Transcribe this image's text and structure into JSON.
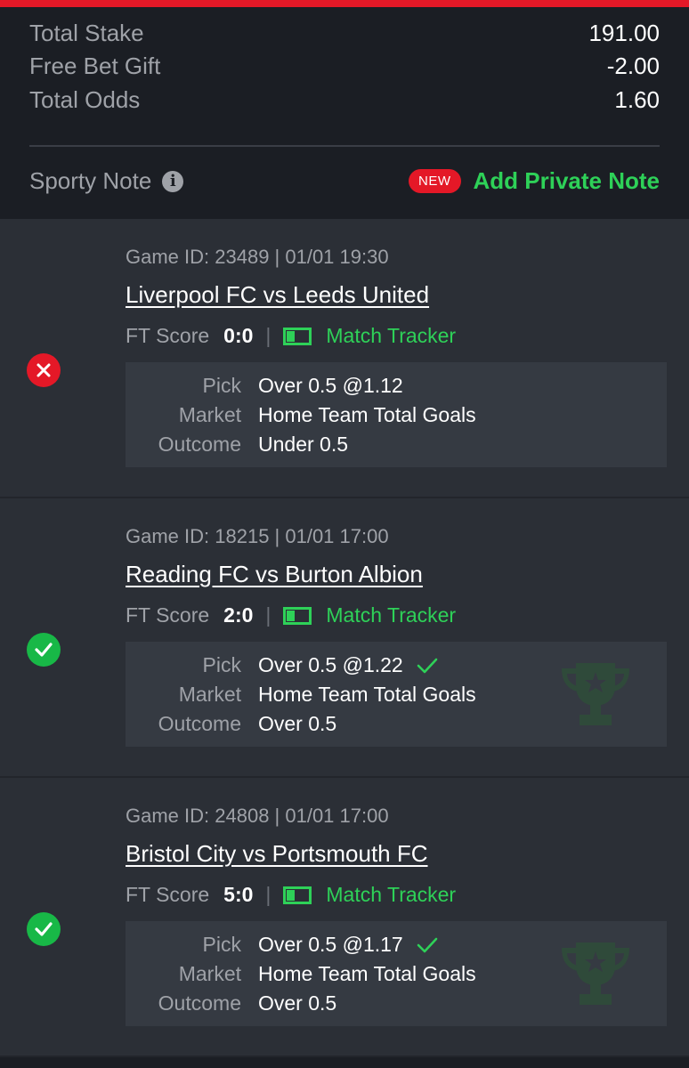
{
  "summary": {
    "total_stake_label": "Total Stake",
    "total_stake_value": "191.00",
    "free_bet_label": "Free Bet Gift",
    "free_bet_value": "-2.00",
    "total_odds_label": "Total Odds",
    "total_odds_value": "1.60"
  },
  "note": {
    "label": "Sporty Note",
    "info_icon": "info-icon",
    "badge": "NEW",
    "action": "Add Private Note"
  },
  "bets": [
    {
      "status": "lost",
      "game_id": "Game ID: 23489 | 01/01 19:30",
      "match": "Liverpool FC vs Leeds United",
      "ft_label": "FT Score",
      "ft_score": "0:0",
      "separator": "|",
      "tracker": "Match Tracker",
      "pick_label": "Pick",
      "pick": "Over 0.5 @1.12",
      "market_label": "Market",
      "market": "Home Team Total Goals",
      "outcome_label": "Outcome",
      "outcome": "Under 0.5"
    },
    {
      "status": "won",
      "game_id": "Game ID: 18215 | 01/01 17:00",
      "match": "Reading FC vs Burton Albion",
      "ft_label": "FT Score",
      "ft_score": "2:0",
      "separator": "|",
      "tracker": "Match Tracker",
      "pick_label": "Pick",
      "pick": "Over 0.5 @1.22",
      "market_label": "Market",
      "market": "Home Team Total Goals",
      "outcome_label": "Outcome",
      "outcome": "Over 0.5"
    },
    {
      "status": "won",
      "game_id": "Game ID: 24808 | 01/01 17:00",
      "match": "Bristol City vs Portsmouth FC",
      "ft_label": "FT Score",
      "ft_score": "5:0",
      "separator": "|",
      "tracker": "Match Tracker",
      "pick_label": "Pick",
      "pick": "Over 0.5 @1.17",
      "market_label": "Market",
      "market": "Home Team Total Goals",
      "outcome_label": "Outcome",
      "outcome": "Over 0.5"
    }
  ],
  "colors": {
    "accent_green": "#2ed158",
    "won_green": "#18b847",
    "lost_red": "#e41827",
    "brand_red": "#e41827"
  }
}
